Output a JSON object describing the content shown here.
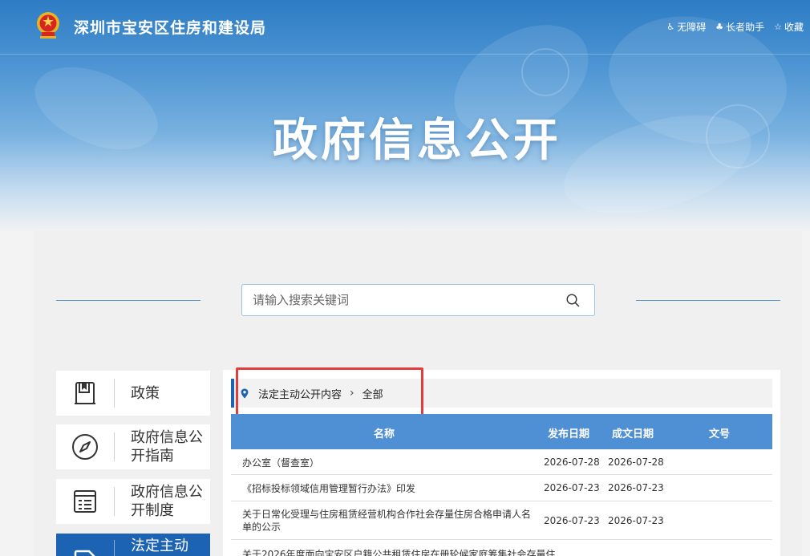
{
  "header": {
    "site_name": "深圳市宝安区住房和建设局",
    "links": [
      {
        "icon": "accessibility-icon",
        "glyph": "♿",
        "label": "无障碍"
      },
      {
        "icon": "elder-helper-icon",
        "glyph": "♣",
        "label": "长者助手"
      },
      {
        "icon": "star-icon",
        "glyph": "☆",
        "label": "收藏"
      }
    ]
  },
  "hero": {
    "title": "政府信息公开"
  },
  "search": {
    "placeholder": "请输入搜索关键词"
  },
  "sidebar": {
    "items": [
      {
        "icon": "book-icon",
        "label": "政策",
        "active": false
      },
      {
        "icon": "compass-icon",
        "label": "政府信息公开指南",
        "active": false
      },
      {
        "icon": "list-doc-icon",
        "label": "政府信息公开制度",
        "active": false
      },
      {
        "icon": "document-icon",
        "label": "法定主动",
        "active": true
      }
    ]
  },
  "breadcrumb": {
    "parent": "法定主动公开内容",
    "current": "全部"
  },
  "table": {
    "headers": {
      "name": "名称",
      "publish_date": "发布日期",
      "doc_date": "成文日期",
      "doc_no": "文号"
    },
    "rows": [
      {
        "name": "办公室（督查室）",
        "publish_date": "2026-07-28",
        "doc_date": "2026-07-28"
      },
      {
        "name": "《招标投标领域信用管理暂行办法》印发",
        "publish_date": "2026-07-23",
        "doc_date": "2026-07-23"
      },
      {
        "name": "关于日常化受理与住房租赁经营机构合作社会存量住房合格申请人名单的公示",
        "publish_date": "2026-07-23",
        "doc_date": "2026-07-23"
      },
      {
        "name": "关于2026年度面向宝安区户籍公共租赁住房在册轮候家庭筹集社会存量住",
        "publish_date": "",
        "doc_date": ""
      }
    ]
  },
  "colors": {
    "primary": "#1d63b3",
    "header_blue": "#4f8fd4",
    "highlight_red": "#e23c3c"
  }
}
